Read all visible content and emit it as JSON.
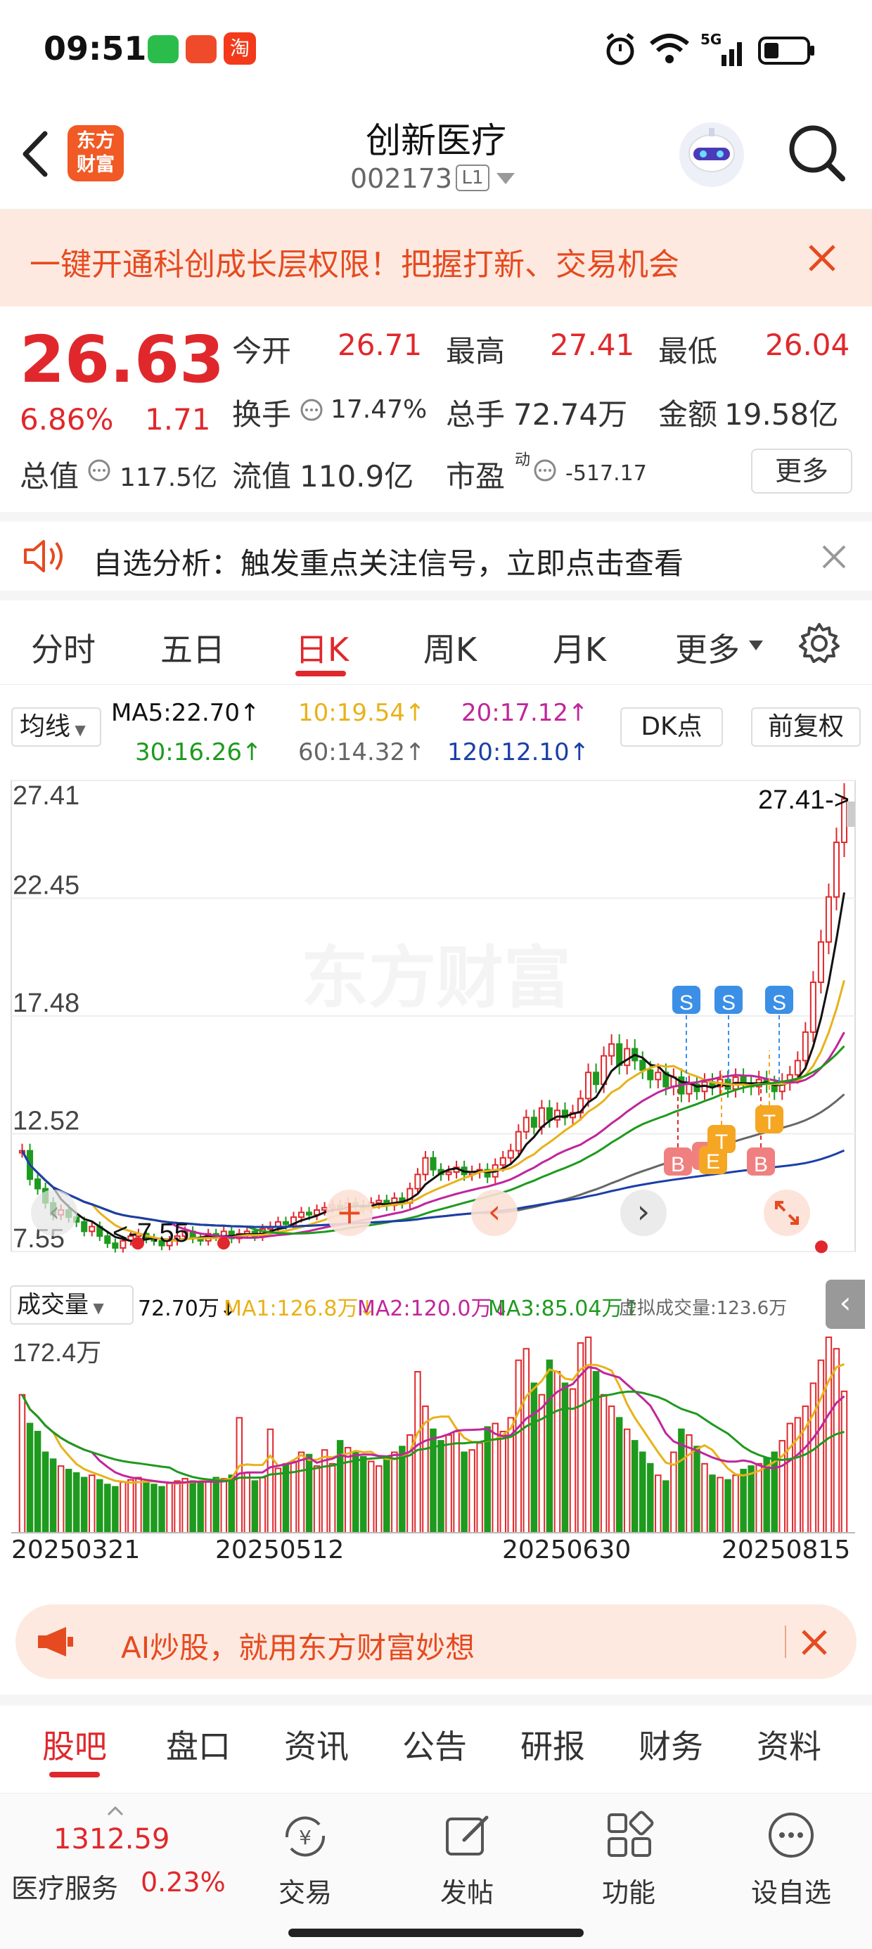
{
  "status": {
    "time": "09:51",
    "signal": "5G"
  },
  "stock": {
    "name": "创新医疗",
    "code": "002173",
    "level": "L1",
    "brand": "东方\n财富"
  },
  "promo": {
    "text": "一键开通科创成长层权限！把握打新、交易机会"
  },
  "quote": {
    "price": "26.63",
    "change_pct": "6.86%",
    "change": "1.71",
    "open_label": "今开",
    "open": "26.71",
    "high_label": "最高",
    "high": "27.41",
    "low_label": "最低",
    "low": "26.04",
    "turnover_label": "换手",
    "turnover": "17.47%",
    "volume_label": "总手",
    "volume": "72.74万",
    "amount_label": "金额",
    "amount": "19.58亿",
    "mcap_label": "总值",
    "mcap": "117.5亿",
    "float_label": "流值",
    "float": "110.9亿",
    "pe_label": "市盈",
    "pe_sup": "动",
    "pe": "-517.17",
    "more": "更多"
  },
  "notice": {
    "text": "自选分析：触发重点关注信号，立即点击查看"
  },
  "period_tabs": [
    "分时",
    "五日",
    "日K",
    "周K",
    "月K",
    "更多"
  ],
  "active_period": 2,
  "ma_bar": {
    "selector": "均线",
    "ma5": "MA5:22.70↑",
    "ma10": "10:19.54↑",
    "ma20": "20:17.12↑",
    "ma30": "30:16.26↑",
    "ma60": "60:14.32↑",
    "ma120": "120:12.10↑",
    "dk": "DK点",
    "adjust": "前复权",
    "colors": {
      "ma5": "#111111",
      "ma10": "#e8b21a",
      "ma20": "#c0269b",
      "ma30": "#1e9a1e",
      "ma60": "#666666",
      "ma120": "#1b3fa8"
    }
  },
  "chart_data": {
    "type": "candlestick",
    "y_ticks": [
      "27.41",
      "22.45",
      "17.48",
      "12.52",
      "7.55"
    ],
    "ylim": [
      7.55,
      27.41
    ],
    "max_label": "27.41->",
    "min_label": "<-7.55",
    "watermark": "东方财富",
    "x_labels": [
      "20250321",
      "20250512",
      "20250630",
      "20250815"
    ],
    "closes": [
      11.8,
      10.6,
      10.2,
      9.6,
      9.1,
      9.3,
      9.0,
      8.8,
      8.4,
      8.6,
      8.2,
      7.9,
      7.7,
      8.0,
      8.2,
      8.3,
      8.1,
      8.0,
      7.8,
      8.0,
      8.2,
      8.4,
      8.1,
      8.0,
      8.3,
      8.2,
      8.4,
      8.1,
      8.3,
      8.4,
      8.2,
      8.5,
      8.6,
      8.8,
      8.7,
      9.0,
      9.2,
      9.1,
      9.3,
      9.4,
      9.5,
      9.3,
      9.6,
      9.5,
      9.4,
      9.6,
      9.7,
      9.5,
      9.8,
      9.6,
      10.2,
      10.8,
      11.5,
      11.0,
      10.8,
      10.9,
      11.1,
      10.8,
      10.9,
      11.0,
      10.7,
      11.2,
      11.5,
      11.8,
      12.6,
      13.2,
      12.8,
      13.6,
      13.1,
      13.5,
      13.2,
      13.4,
      14.0,
      15.1,
      14.6,
      15.8,
      16.3,
      15.4,
      16.1,
      15.6,
      15.2,
      14.8,
      15.1,
      14.5,
      14.9,
      14.2,
      14.6,
      14.3,
      14.7,
      14.5,
      14.8,
      14.4,
      14.9,
      14.6,
      14.5,
      14.8,
      14.6,
      14.3,
      14.7,
      15.0,
      15.6,
      16.8,
      18.9,
      20.6,
      22.5,
      24.8,
      26.63
    ],
    "volumes": [
      120,
      95,
      88,
      70,
      64,
      58,
      55,
      52,
      48,
      50,
      46,
      42,
      40,
      44,
      46,
      48,
      44,
      42,
      40,
      43,
      45,
      47,
      45,
      44,
      46,
      48,
      47,
      50,
      100,
      52,
      45,
      48,
      90,
      56,
      60,
      62,
      70,
      68,
      58,
      72,
      60,
      80,
      74,
      70,
      66,
      62,
      58,
      64,
      70,
      75,
      85,
      140,
      110,
      90,
      80,
      85,
      88,
      70,
      72,
      78,
      92,
      95,
      88,
      100,
      150,
      160,
      130,
      120,
      150,
      140,
      130,
      125,
      165,
      170,
      140,
      120,
      110,
      100,
      90,
      80,
      70,
      60,
      50,
      45,
      70,
      90,
      85,
      75,
      60,
      50,
      48,
      46,
      50,
      55,
      58,
      60,
      65,
      70,
      80,
      95,
      100,
      110,
      130,
      150,
      170,
      160,
      123
    ],
    "vol_ylabel": "172.4万",
    "vol_bar": {
      "title": "成交量",
      "v": "72.70万↓",
      "ma1": "MA1:126.8万↓",
      "ma2": "MA2:120.0万↓",
      "ma3": "MA3:85.04万↑",
      "virtual": "虚拟成交量:123.6万"
    },
    "signals": {
      "S": [
        "S",
        "S",
        "S"
      ],
      "B": [
        "B",
        "B",
        "B"
      ],
      "T": [
        "T",
        "T"
      ],
      "E": [
        "E"
      ]
    }
  },
  "ai_banner": {
    "text": "AI炒股，就用东方财富妙想"
  },
  "bottom_tabs": [
    "股吧",
    "盘口",
    "资讯",
    "公告",
    "研报",
    "财务",
    "资料"
  ],
  "footer": {
    "index_value": "1312.59",
    "index_name": "医疗服务",
    "index_pct": "0.23%",
    "trade": "交易",
    "post": "发帖",
    "func": "功能",
    "watch": "设自选"
  }
}
